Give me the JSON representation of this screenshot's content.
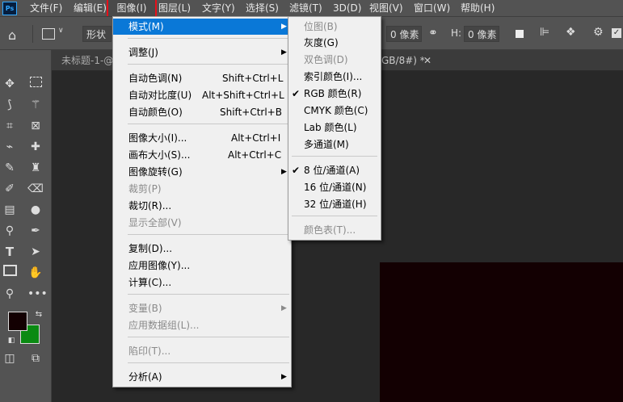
{
  "menubar": {
    "logo": "Ps",
    "items": [
      "文件(F)",
      "编辑(E)",
      "图像(I)",
      "图层(L)",
      "文字(Y)",
      "选择(S)",
      "滤镜(T)",
      "3D(D)",
      "视图(V)",
      "窗口(W)",
      "帮助(H)"
    ],
    "active_index": 2
  },
  "options": {
    "shape_label": "形状",
    "w_value": "0 像素",
    "h_label": "H:",
    "h_value": "0 像素"
  },
  "tabs": {
    "doc1": "未标题-1-@",
    "doc2": "GB/8#) *",
    "close": "✕"
  },
  "image_menu": {
    "items": [
      {
        "label": "模式(M)",
        "submenu": true,
        "highlighted": true
      },
      {
        "label": "调整(J)",
        "submenu": true
      },
      {
        "label": "自动色调(N)",
        "shortcut": "Shift+Ctrl+L"
      },
      {
        "label": "自动对比度(U)",
        "shortcut": "Alt+Shift+Ctrl+L"
      },
      {
        "label": "自动颜色(O)",
        "shortcut": "Shift+Ctrl+B"
      },
      {
        "label": "图像大小(I)...",
        "shortcut": "Alt+Ctrl+I"
      },
      {
        "label": "画布大小(S)...",
        "shortcut": "Alt+Ctrl+C"
      },
      {
        "label": "图像旋转(G)",
        "submenu": true
      },
      {
        "label": "裁剪(P)",
        "disabled": true
      },
      {
        "label": "裁切(R)..."
      },
      {
        "label": "显示全部(V)",
        "disabled": true
      },
      {
        "label": "复制(D)..."
      },
      {
        "label": "应用图像(Y)..."
      },
      {
        "label": "计算(C)..."
      },
      {
        "label": "变量(B)",
        "submenu": true,
        "disabled": true
      },
      {
        "label": "应用数据组(L)...",
        "disabled": true
      },
      {
        "label": "陷印(T)...",
        "disabled": true
      },
      {
        "label": "分析(A)",
        "submenu": true
      }
    ]
  },
  "mode_submenu": {
    "items": [
      {
        "label": "位图(B)",
        "disabled": true
      },
      {
        "label": "灰度(G)"
      },
      {
        "label": "双色调(D)",
        "disabled": true
      },
      {
        "label": "索引颜色(I)..."
      },
      {
        "label": "RGB 颜色(R)",
        "checked": true
      },
      {
        "label": "CMYK 颜色(C)"
      },
      {
        "label": "Lab 颜色(L)"
      },
      {
        "label": "多通道(M)"
      },
      {
        "label": "8 位/通道(A)",
        "checked": true
      },
      {
        "label": "16 位/通道(N)"
      },
      {
        "label": "32 位/通道(H)"
      },
      {
        "label": "颜色表(T)...",
        "disabled": true
      }
    ],
    "check_mark": "✔",
    "arrow": "▶"
  },
  "colors": {
    "foreground": "#130002",
    "background": "#0a8a12",
    "highlight": "#0a78d7"
  }
}
